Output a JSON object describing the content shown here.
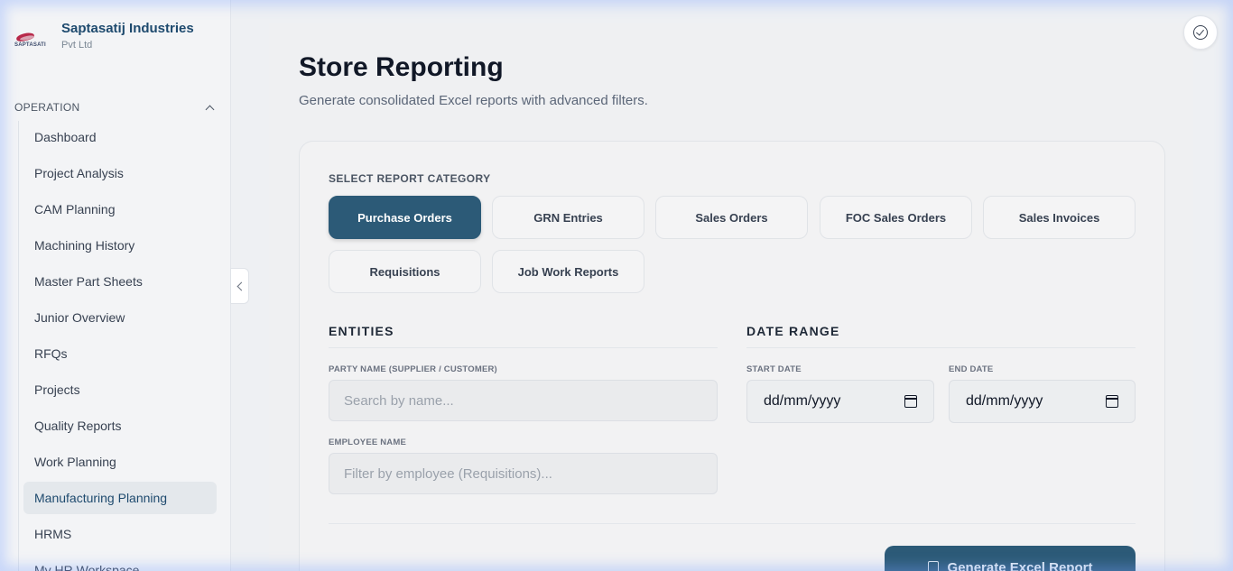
{
  "brand": {
    "logo_text": "SAPTASATI",
    "name": "Saptasatij Industries",
    "sub": "Pvt Ltd"
  },
  "sidebar": {
    "section": "OPERATION",
    "items": [
      {
        "label": "Dashboard"
      },
      {
        "label": "Project Analysis"
      },
      {
        "label": "CAM Planning"
      },
      {
        "label": "Machining History"
      },
      {
        "label": "Master Part Sheets"
      },
      {
        "label": "Junior Overview"
      },
      {
        "label": "RFQs"
      },
      {
        "label": "Projects"
      },
      {
        "label": "Quality Reports"
      },
      {
        "label": "Work Planning"
      },
      {
        "label": "Manufacturing Planning"
      },
      {
        "label": "HRMS"
      },
      {
        "label": "My HR Workspace"
      }
    ]
  },
  "page": {
    "title": "Store Reporting",
    "subtitle": "Generate consolidated Excel reports with advanced filters."
  },
  "categories": {
    "label": "SELECT REPORT CATEGORY",
    "items": [
      {
        "label": "Purchase Orders"
      },
      {
        "label": "GRN Entries"
      },
      {
        "label": "Sales Orders"
      },
      {
        "label": "FOC Sales Orders"
      },
      {
        "label": "Sales Invoices"
      },
      {
        "label": "Requisitions"
      },
      {
        "label": "Job Work Reports"
      }
    ]
  },
  "entities": {
    "title": "ENTITIES",
    "party_label": "PARTY NAME (SUPPLIER / CUSTOMER)",
    "party_placeholder": "Search by name...",
    "employee_label": "EMPLOYEE NAME",
    "employee_placeholder": "Filter by employee (Requisitions)..."
  },
  "date_range": {
    "title": "DATE RANGE",
    "start_label": "START DATE",
    "start_value": "dd/mm/yyyy",
    "end_label": "END DATE",
    "end_value": "dd/mm/yyyy"
  },
  "actions": {
    "generate_label": "Generate Excel Report"
  },
  "colors": {
    "accent": "#2c5a77",
    "brand": "#1e4a6e",
    "logo": "#b8294a"
  }
}
